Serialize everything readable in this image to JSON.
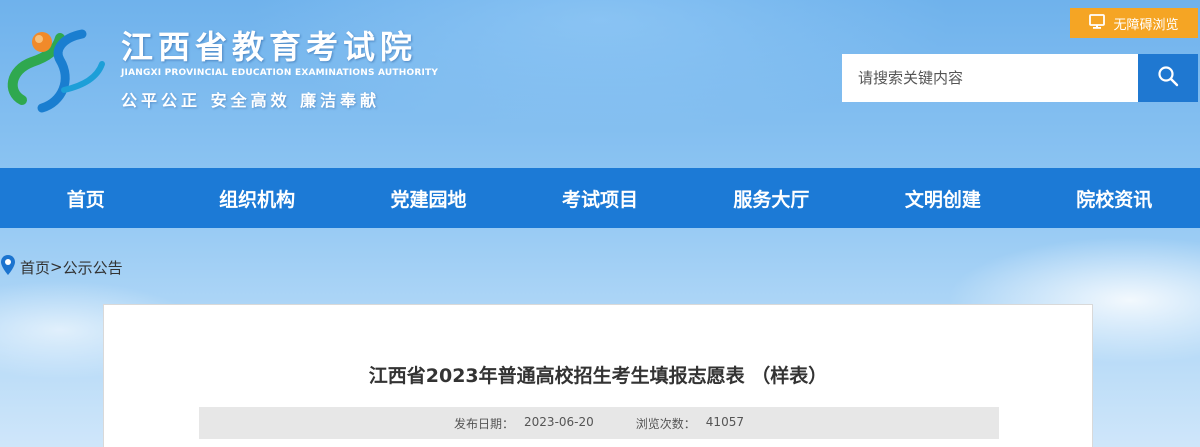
{
  "header": {
    "site_title": "江西省教育考试院",
    "site_subtitle": "JIANGXI PROVINCIAL EDUCATION EXAMINATIONS AUTHORITY",
    "slogan": "公平公正  安全高效  廉洁奉献",
    "logo_icon": "jx-logo-icon",
    "accessibility_label": "无障碍浏览",
    "accessibility_icon": "monitor-icon",
    "search": {
      "placeholder": "请搜索关键内容",
      "value": "",
      "icon": "search-icon"
    }
  },
  "nav": {
    "items": [
      {
        "label": "首页"
      },
      {
        "label": "组织机构"
      },
      {
        "label": "党建园地"
      },
      {
        "label": "考试项目"
      },
      {
        "label": "服务大厅"
      },
      {
        "label": "文明创建"
      },
      {
        "label": "院校资讯"
      }
    ]
  },
  "breadcrumb": {
    "icon": "location-pin-icon",
    "home": "首页",
    "separator": ">",
    "current": "公示公告"
  },
  "article": {
    "title": "江西省2023年普通高校招生考生填报志愿表 （样表）",
    "publish_label": "发布日期：",
    "publish_date": "2023-06-20",
    "views_label": "浏览次数：",
    "views_count": "41057"
  },
  "colors": {
    "nav_bg": "#1c7ad6",
    "accessibility_bg": "#f5a524",
    "search_button_bg": "#1f78d1",
    "pin_color": "#1c74cf"
  }
}
